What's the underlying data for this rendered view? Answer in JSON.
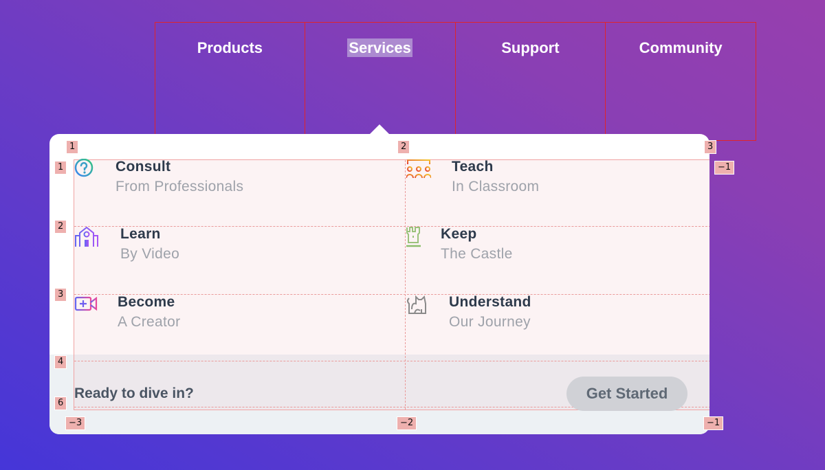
{
  "nav": {
    "items": [
      {
        "label": "Products",
        "active": false
      },
      {
        "label": "Services",
        "active": true
      },
      {
        "label": "Support",
        "active": false
      },
      {
        "label": "Community",
        "active": false
      }
    ]
  },
  "menu": {
    "items": [
      {
        "title": "Consult",
        "subtitle": "From Professionals",
        "icon": "question-circle-icon"
      },
      {
        "title": "Teach",
        "subtitle": "In Classroom",
        "icon": "classroom-icon"
      },
      {
        "title": "Learn",
        "subtitle": "By Video",
        "icon": "school-icon"
      },
      {
        "title": "Keep",
        "subtitle": "The Castle",
        "icon": "castle-tower-icon"
      },
      {
        "title": "Become",
        "subtitle": "A Creator",
        "icon": "video-plus-icon"
      },
      {
        "title": "Understand",
        "subtitle": "Our Journey",
        "icon": "cat-icon"
      }
    ],
    "footer_text": "Ready to dive in?",
    "cta_label": "Get Started"
  },
  "overlay": {
    "column_tags": [
      "1",
      "2",
      "3"
    ],
    "row_tags": [
      "1",
      "2",
      "3",
      "4",
      "6"
    ],
    "end_tags_bottom": [
      "−3",
      "−2",
      "−1"
    ],
    "end_tag_right": "−1"
  }
}
